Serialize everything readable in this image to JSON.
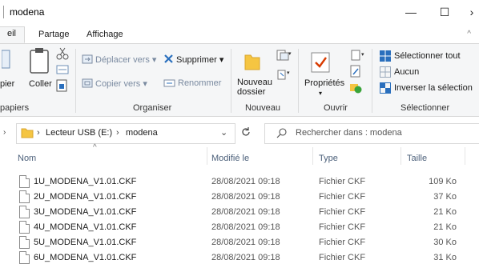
{
  "window": {
    "title": "modena",
    "controls": {
      "minimize": "—",
      "maximize": "☐",
      "close": "›"
    }
  },
  "ribbon_tabs": [
    "eil",
    "Partage",
    "Affichage"
  ],
  "ribbon": {
    "clipboard": {
      "copy_label": "pier",
      "paste_label": "Coller",
      "group_label": "papiers"
    },
    "organize": {
      "move_to": "Déplacer vers",
      "copy_to": "Copier vers",
      "delete": "Supprimer",
      "rename": "Renommer",
      "group_label": "Organiser"
    },
    "new": {
      "new_folder_line1": "Nouveau",
      "new_folder_line2": "dossier",
      "group_label": "Nouveau"
    },
    "open": {
      "properties": "Propriétés",
      "group_label": "Ouvrir"
    },
    "select": {
      "select_all": "Sélectionner tout",
      "select_none": "Aucun",
      "invert": "Inverser la sélection",
      "group_label": "Sélectionner"
    }
  },
  "address": {
    "crumbs": [
      "Lecteur USB (E:)",
      "modena"
    ],
    "search_placeholder": "Rechercher dans : modena"
  },
  "columns": {
    "name": "Nom",
    "modified": "Modifié le",
    "type": "Type",
    "size": "Taille"
  },
  "files": [
    {
      "name": "1U_MODENA_V1.01.CKF",
      "modified": "28/08/2021 09:18",
      "type": "Fichier CKF",
      "size": "109 Ko"
    },
    {
      "name": "2U_MODENA_V1.01.CKF",
      "modified": "28/08/2021 09:18",
      "type": "Fichier CKF",
      "size": "37 Ko"
    },
    {
      "name": "3U_MODENA_V1.01.CKF",
      "modified": "28/08/2021 09:18",
      "type": "Fichier CKF",
      "size": "21 Ko"
    },
    {
      "name": "4U_MODENA_V1.01.CKF",
      "modified": "28/08/2021 09:18",
      "type": "Fichier CKF",
      "size": "21 Ko"
    },
    {
      "name": "5U_MODENA_V1.01.CKF",
      "modified": "28/08/2021 09:18",
      "type": "Fichier CKF",
      "size": "30 Ko"
    },
    {
      "name": "6U_MODENA_V1.01.CKF",
      "modified": "28/08/2021 09:18",
      "type": "Fichier CKF",
      "size": "31 Ko"
    }
  ],
  "colors": {
    "accent": "#0078d7",
    "folder": "#e8b73a",
    "header_text": "#4c607a"
  }
}
